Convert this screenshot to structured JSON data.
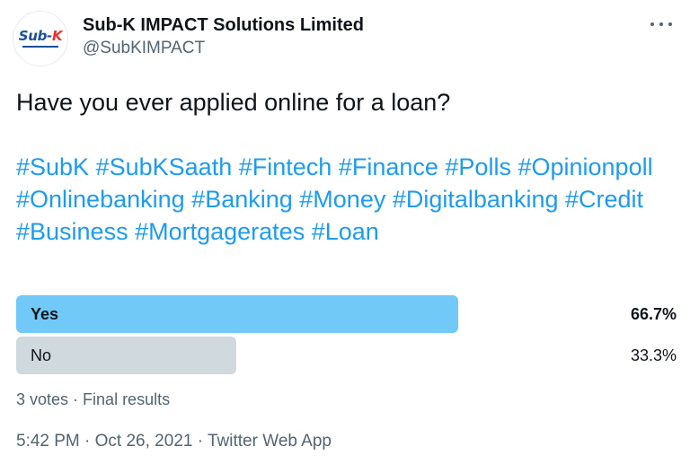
{
  "author": {
    "display_name": "Sub-K IMPACT Solutions Limited",
    "handle": "@SubKIMPACT",
    "avatar_logo_main": "Sub-",
    "avatar_logo_accent": "K",
    "brand_color": "#1b4f9c",
    "accent_color": "#e8312f"
  },
  "more_icon": "more-horizontal-icon",
  "tweet": {
    "question": "Have you ever applied online for a loan?",
    "hashtags": [
      "#SubK",
      "#SubKSaath",
      "#Fintech",
      "#Finance",
      "#Polls",
      "#Opinionpoll",
      "#Onlinebanking",
      "#Banking",
      "#Money",
      "#Digitalbanking",
      "#Credit",
      "#Business",
      "#Mortgagerates",
      "#Loan"
    ],
    "hashtag_color": "#1d9bf0"
  },
  "poll": {
    "options": [
      {
        "label": "Yes",
        "percent": "66.7%",
        "share": 0.667,
        "winner": true
      },
      {
        "label": "No",
        "percent": "33.3%",
        "share": 0.333,
        "winner": false
      }
    ],
    "winner_color": "#71c9f8",
    "loser_color": "#cfd9de",
    "summary": {
      "votes": "3 votes",
      "separator": " · ",
      "status": "Final results"
    }
  },
  "meta": {
    "time": "5:42 PM",
    "date": "Oct 26, 2021",
    "source": "Twitter Web App",
    "separator": " · "
  }
}
